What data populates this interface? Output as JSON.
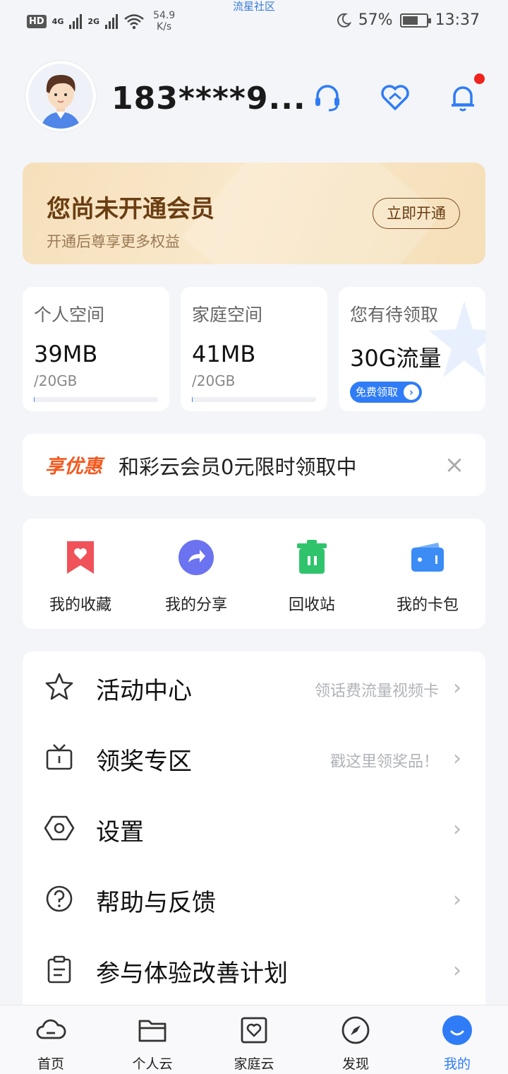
{
  "status_bar": {
    "hd": "HD",
    "net1": "4G",
    "net2": "2G",
    "speed_value": "54.9",
    "speed_unit": "K/s",
    "carrier_center": "流星社区",
    "battery": "57%",
    "time": "13:37"
  },
  "header": {
    "username": "183****9...",
    "icons": [
      "headset-icon",
      "heart-icon",
      "bell-icon"
    ],
    "has_notification": true
  },
  "vip": {
    "title": "您尚未开通会员",
    "subtitle": "开通后尊享更多权益",
    "button": "立即开通"
  },
  "storage_cards": [
    {
      "label": "个人空间",
      "value": "39MB",
      "total": "/20GB",
      "usage_fraction": 0.002
    },
    {
      "label": "家庭空间",
      "value": "41MB",
      "total": "/20GB",
      "usage_fraction": 0.002
    },
    {
      "label": "您有待领取",
      "value": "30G流量",
      "button": "免费领取"
    }
  ],
  "promo": {
    "tag": "享优惠",
    "text": "和彩云会员0元限时领取中"
  },
  "quick_actions": [
    {
      "label": "我的收藏",
      "icon": "bookmark-icon",
      "color": "#f0525a"
    },
    {
      "label": "我的分享",
      "icon": "share-icon",
      "color": "#6b73f0"
    },
    {
      "label": "回收站",
      "icon": "trash-icon",
      "color": "#2fc46c"
    },
    {
      "label": "我的卡包",
      "icon": "wallet-icon",
      "color": "#3b8cf5"
    }
  ],
  "menu": [
    {
      "label": "活动中心",
      "hint": "领话费流量视频卡",
      "icon": "star-icon"
    },
    {
      "label": "领奖专区",
      "hint": "戳这里领奖品！",
      "icon": "gift-tv-icon"
    },
    {
      "label": "设置",
      "hint": "",
      "icon": "settings-icon"
    },
    {
      "label": "帮助与反馈",
      "hint": "",
      "icon": "help-icon"
    },
    {
      "label": "参与体验改善计划",
      "hint": "",
      "icon": "clipboard-icon"
    }
  ],
  "tabs": [
    {
      "label": "首页",
      "icon": "cloud-icon",
      "active": false
    },
    {
      "label": "个人云",
      "icon": "folder-icon",
      "active": false
    },
    {
      "label": "家庭云",
      "icon": "family-icon",
      "active": false
    },
    {
      "label": "发现",
      "icon": "compass-icon",
      "active": false
    },
    {
      "label": "我的",
      "icon": "profile-icon",
      "active": true
    }
  ],
  "colors": {
    "accent": "#2f7cf6",
    "vip_text": "#6a3d12",
    "promo_tag": "#f2591f",
    "notification": "#f0221e"
  }
}
